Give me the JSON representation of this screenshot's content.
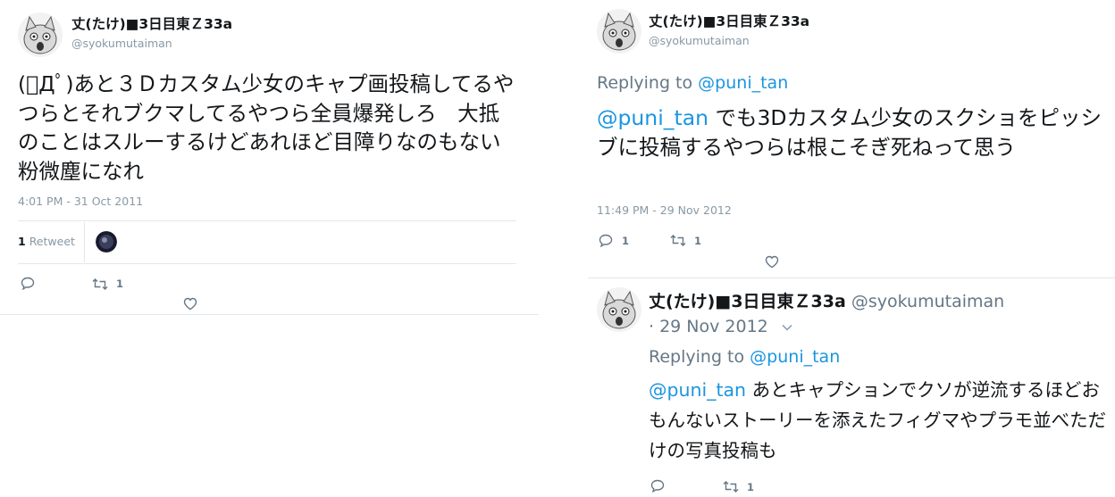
{
  "left_tweet": {
    "display_name": "丈(たけ)■3日目東Ｚ33a",
    "handle": "@syokumutaiman",
    "text": "(ﾟДﾟ)あと３Ｄカスタム少女のキャプ画投稿してるやつらとそれブクマしてるやつら全員爆発しろ　大抵のことはスルーするけどあれほど目障りなのもない　粉微塵になれ",
    "timestamp": "4:01 PM - 31 Oct 2011",
    "retweet_count": "1",
    "retweet_label": "Retweet",
    "action_retweet_count": "1"
  },
  "right_tweet_1": {
    "display_name": "丈(たけ)■3日目東Ｚ33a",
    "handle": "@syokumutaiman",
    "replying_prefix": "Replying to",
    "replying_handle": "@puni_tan",
    "mention": "@puni_tan",
    "text": " でも3Dカスタム少女のスクショをピッシブに投稿するやつらは根こそぎ死ねって思う",
    "timestamp": "11:49 PM - 29 Nov 2012",
    "reply_count": "1",
    "retweet_count": "1"
  },
  "right_tweet_2": {
    "display_name": "丈(たけ)■3日目東Ｚ33a",
    "handle": "@syokumutaiman",
    "date": "· 29 Nov 2012",
    "replying_prefix": "Replying to",
    "replying_handle": "@puni_tan",
    "mention": "@puni_tan",
    "text": " あとキャプションでクソが逆流するほどおもんないストーリーを添えたフィグマやプラモ並べただけの写真投稿も",
    "retweet_count": "1"
  },
  "colors": {
    "link": "#1b95e0",
    "secondary_text": "#8899a6",
    "separator": "#e1e8ed"
  }
}
